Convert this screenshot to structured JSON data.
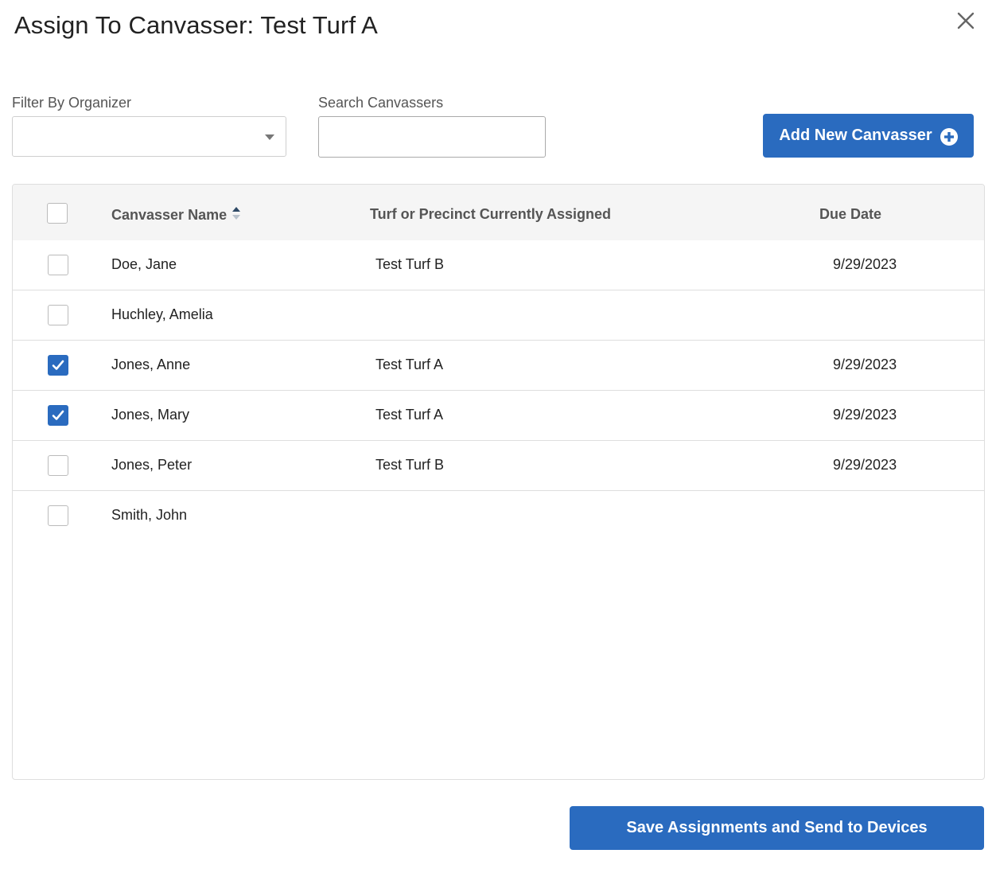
{
  "dialog": {
    "title": "Assign To Canvasser: Test Turf A",
    "close_icon": "close-icon"
  },
  "filters": {
    "organizer_label": "Filter By Organizer",
    "organizer_value": "",
    "search_label": "Search Canvassers",
    "search_value": "",
    "search_placeholder": ""
  },
  "actions": {
    "add_label": "Add New Canvasser",
    "add_icon": "plus-circle-icon",
    "save_label": "Save Assignments and Send to Devices"
  },
  "table": {
    "headers": {
      "name": "Canvasser Name",
      "turf": "Turf or Precinct Currently Assigned",
      "due": "Due Date"
    },
    "sort_icon": "sort-icon",
    "rows": [
      {
        "name": "Doe, Jane",
        "turf": "Test Turf B",
        "due": "9/29/2023",
        "checked": false
      },
      {
        "name": "Huchley, Amelia",
        "turf": "",
        "due": "",
        "checked": false
      },
      {
        "name": "Jones, Anne",
        "turf": "Test Turf A",
        "due": "9/29/2023",
        "checked": true
      },
      {
        "name": "Jones, Mary",
        "turf": "Test Turf A",
        "due": "9/29/2023",
        "checked": true
      },
      {
        "name": "Jones, Peter",
        "turf": "Test Turf B",
        "due": "9/29/2023",
        "checked": false
      },
      {
        "name": "Smith, John",
        "turf": "",
        "due": "",
        "checked": false
      }
    ]
  },
  "colors": {
    "primary": "#2a6bbf",
    "header_bg": "#f5f5f5",
    "border": "#dedede"
  }
}
